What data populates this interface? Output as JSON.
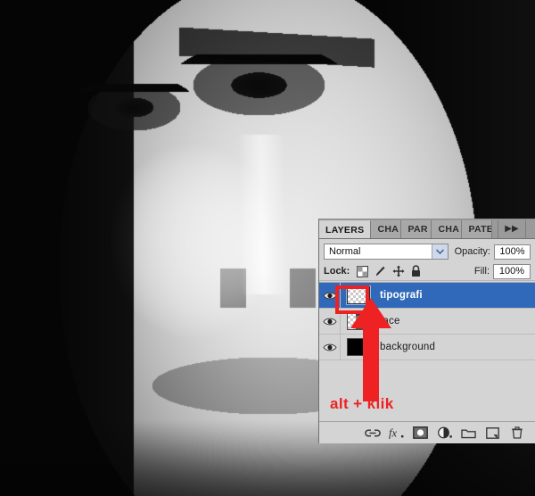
{
  "app": {
    "panel_title": "LAYERS"
  },
  "panel": {
    "tabs": [
      {
        "label": "LAYERS",
        "active": true
      },
      {
        "label": "CHA",
        "active": false
      },
      {
        "label": "PAR",
        "active": false
      },
      {
        "label": "CHA",
        "active": false
      },
      {
        "label": "PATE",
        "active": false
      }
    ],
    "collapse_icon": "▶▶",
    "blend_mode": "Normal",
    "opacity_label": "Opacity:",
    "opacity_value": "100%",
    "lock_label": "Lock:",
    "lock_icons": [
      "lock-transparent-pixels-icon",
      "lock-image-pixels-icon",
      "lock-position-icon",
      "lock-all-icon"
    ],
    "fill_label": "Fill:",
    "fill_value": "100%",
    "layers": [
      {
        "name": "tipografi",
        "visible": true,
        "selected": true,
        "thumb": "transparent"
      },
      {
        "name": "face",
        "visible": true,
        "selected": false,
        "thumb": "face"
      },
      {
        "name": "background",
        "visible": true,
        "selected": false,
        "thumb": "black"
      }
    ],
    "bottom_icons": [
      "link-layers-icon",
      "layer-style-fx-icon",
      "add-layer-mask-icon",
      "adjustment-layer-icon",
      "new-group-folder-icon",
      "new-layer-icon",
      "delete-layer-trash-icon"
    ]
  },
  "annotation": {
    "instruction": "alt + klik",
    "color": "#ee2222",
    "arrow": "red-up-arrow",
    "highlight": "red-rectangle-around-layer-thumbnail"
  },
  "colors": {
    "panel_bg": "#d4d4d4",
    "tab_inactive": "#a8a8a8",
    "selected_layer": "#3169ba",
    "annotation_red": "#ee2222",
    "field_bg": "#ffffff"
  }
}
